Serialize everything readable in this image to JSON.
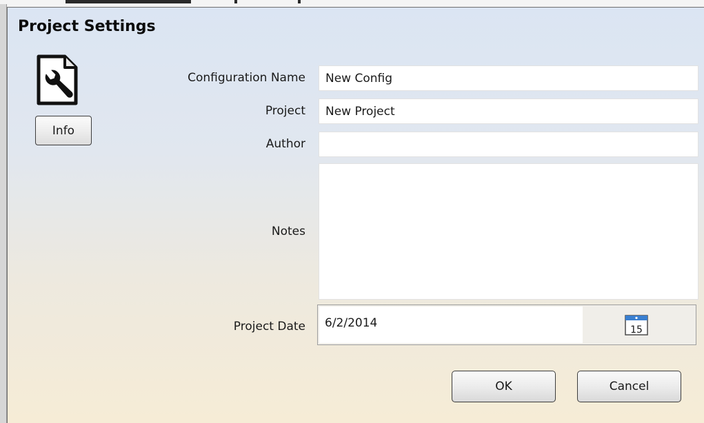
{
  "dialog": {
    "title": "Project Settings",
    "icon": "settings-document-icon",
    "info_button": "Info"
  },
  "fields": {
    "configuration_name": {
      "label": "Configuration Name",
      "value": "New Config"
    },
    "project": {
      "label": "Project",
      "value": "New Project"
    },
    "author": {
      "label": "Author",
      "value": ""
    },
    "notes": {
      "label": "Notes",
      "value": ""
    },
    "project_date": {
      "label": "Project Date",
      "value": "6/2/2014",
      "calendar_icon": "calendar-icon",
      "calendar_day": "15"
    }
  },
  "buttons": {
    "ok": "OK",
    "cancel": "Cancel"
  },
  "colors": {
    "gradient_top": "#dbe5f3",
    "gradient_bottom": "#f6ecd6",
    "calendar_accent": "#3a7fd0"
  }
}
